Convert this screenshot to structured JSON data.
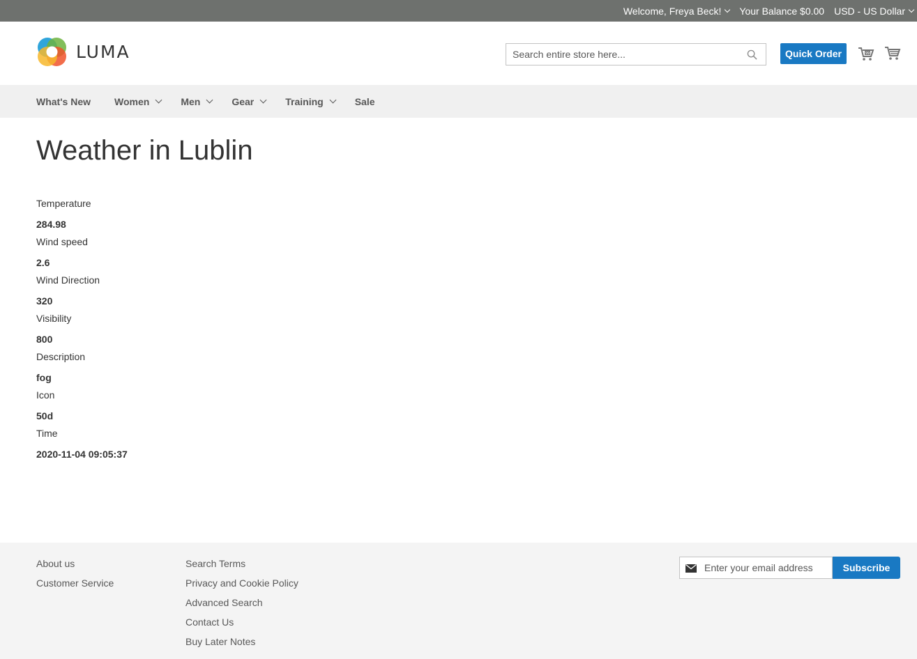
{
  "top_panel": {
    "welcome": "Welcome, Freya Beck!",
    "balance": "Your Balance $0.00",
    "currency": "USD - US Dollar"
  },
  "header": {
    "logo_text": "LUMA",
    "search_placeholder": "Search entire store here...",
    "quick_order_label": "Quick Order"
  },
  "nav": {
    "items": [
      {
        "label": "What's New"
      },
      {
        "label": "Women"
      },
      {
        "label": "Men"
      },
      {
        "label": "Gear"
      },
      {
        "label": "Training"
      },
      {
        "label": "Sale"
      }
    ]
  },
  "main": {
    "title": "Weather in Lublin",
    "fields": [
      {
        "label": "Temperature",
        "value": "284.98"
      },
      {
        "label": "Wind speed",
        "value": "2.6"
      },
      {
        "label": "Wind Direction",
        "value": "320"
      },
      {
        "label": "Visibility",
        "value": "800"
      },
      {
        "label": "Description",
        "value": "fog"
      },
      {
        "label": "Icon",
        "value": "50d"
      },
      {
        "label": "Time",
        "value": "2020-11-04 09:05:37"
      }
    ]
  },
  "footer": {
    "col1": [
      "About us",
      "Customer Service"
    ],
    "col2": [
      "Search Terms",
      "Privacy and Cookie Policy",
      "Advanced Search",
      "Contact Us",
      "Buy Later Notes"
    ],
    "newsletter_placeholder": "Enter your email address",
    "subscribe_label": "Subscribe"
  },
  "colors": {
    "top_bar": "#6e716e",
    "accent": "#1979c3",
    "nav_bg": "#f0f0f0",
    "footer_bg": "#f4f4f4"
  }
}
